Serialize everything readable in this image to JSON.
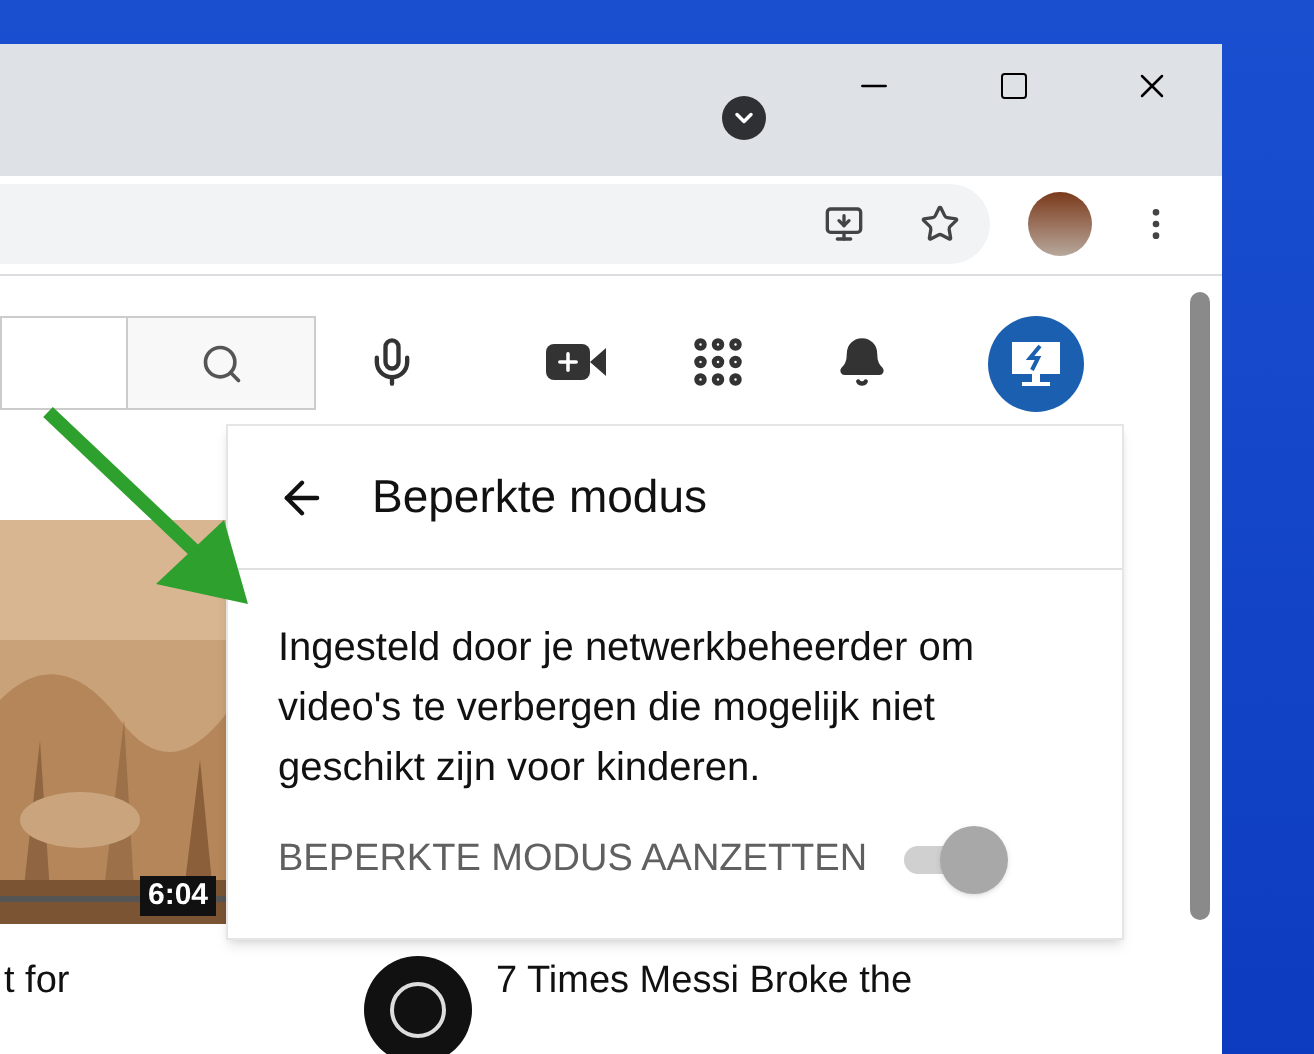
{
  "video_grid": {
    "thumbnail": {
      "kind": "picture",
      "duration": "6:04"
    },
    "titles": [
      {
        "kind": "plain",
        "text": "t for"
      },
      {
        "kind": "with_channel",
        "text": "7 Times Messi Broke the"
      }
    ]
  },
  "restricted_mode_panel": {
    "title": "Beperkte modus",
    "description": "Ingesteld door je netwerkbeheerder om video's te verbergen die mogelijk niet geschikt zijn voor kinderen.",
    "toggle": {
      "label": "BEPERKTE MODUS AANZETTEN",
      "on": true,
      "disabled": true
    }
  }
}
